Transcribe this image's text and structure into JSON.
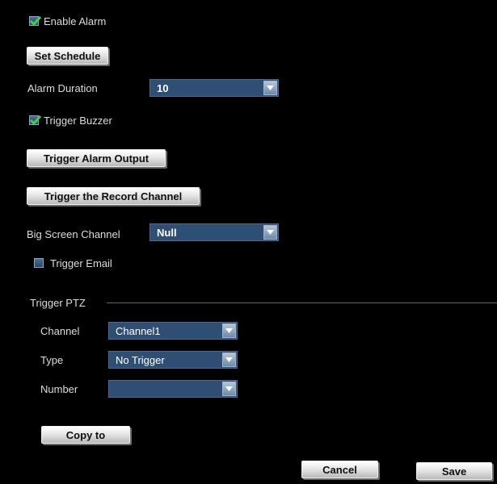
{
  "alarm": {
    "enable_alarm_label": "Enable Alarm",
    "enable_alarm_checked": true,
    "set_schedule_label": "Set Schedule",
    "alarm_duration_label": "Alarm Duration",
    "alarm_duration_value": "10",
    "trigger_buzzer_label": "Trigger Buzzer",
    "trigger_buzzer_checked": true,
    "trigger_alarm_output_label": "Trigger Alarm Output",
    "trigger_record_channel_label": "Trigger the Record Channel",
    "big_screen_channel_label": "Big Screen Channel",
    "big_screen_channel_value": "Null",
    "trigger_email_label": "Trigger Email",
    "trigger_email_checked": false
  },
  "ptz": {
    "section_label": "Trigger PTZ",
    "channel_label": "Channel",
    "channel_value": "Channel1",
    "type_label": "Type",
    "type_value": "No Trigger",
    "number_label": "Number",
    "number_value": "",
    "copy_to_label": "Copy to"
  },
  "footer": {
    "cancel_label": "Cancel",
    "save_label": "Save"
  },
  "colors": {
    "background": "#000000",
    "select_fill": "#2f4e73",
    "check_green": "#3fd14a"
  }
}
